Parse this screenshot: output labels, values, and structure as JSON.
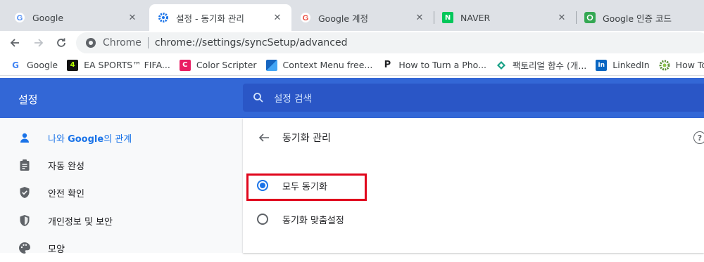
{
  "tabs": [
    {
      "title": "Google",
      "icon": "google-icon",
      "active": false
    },
    {
      "title": "설정 - 동기화 관리",
      "icon": "settings-gear-icon",
      "active": true
    },
    {
      "title": "Google 계정",
      "icon": "google-icon",
      "active": false
    },
    {
      "title": "NAVER",
      "icon": "naver-icon",
      "active": false
    },
    {
      "title": "Google 인증 코드",
      "icon": "authenticator-icon",
      "active": false
    }
  ],
  "toolbar": {
    "chip": "Chrome",
    "url": "chrome://settings/syncSetup/advanced"
  },
  "bookmarks": [
    {
      "label": "Google",
      "icon": "google-icon"
    },
    {
      "label": "EA SPORTS™ FIFA...",
      "icon": "ea-sports-icon"
    },
    {
      "label": "Color Scripter",
      "icon": "color-scripter-icon"
    },
    {
      "label": "Context Menu free...",
      "icon": "context-menu-icon"
    },
    {
      "label": "How to Turn a Pho...",
      "icon": "p-icon"
    },
    {
      "label": "팩토리얼 함수 (개...",
      "icon": "diamond-icon"
    },
    {
      "label": "LinkedIn",
      "icon": "linkedin-icon"
    },
    {
      "label": "How To Check",
      "icon": "gear-green-icon"
    }
  ],
  "settings": {
    "title": "설정",
    "search_placeholder": "설정 검색"
  },
  "sidebar": [
    {
      "label_prefix": "나와 ",
      "label_bold": "Google",
      "label_suffix": "의 관계",
      "icon": "person-icon",
      "active": true
    },
    {
      "label": "자동 완성",
      "icon": "clipboard-icon"
    },
    {
      "label": "안전 확인",
      "icon": "shield-check-icon"
    },
    {
      "label": "개인정보 및 보안",
      "icon": "shield-icon"
    },
    {
      "label": "모양",
      "icon": "palette-icon"
    }
  ],
  "main": {
    "subpage_title": "동기화 관리",
    "options": [
      {
        "label": "모두 동기화",
        "checked": true
      },
      {
        "label": "동기화 맞춤설정",
        "checked": false
      }
    ],
    "help": "?"
  },
  "colors": {
    "header_bg": "#3367d6",
    "accent": "#1a73e8",
    "highlight_box": "#e0061c"
  }
}
